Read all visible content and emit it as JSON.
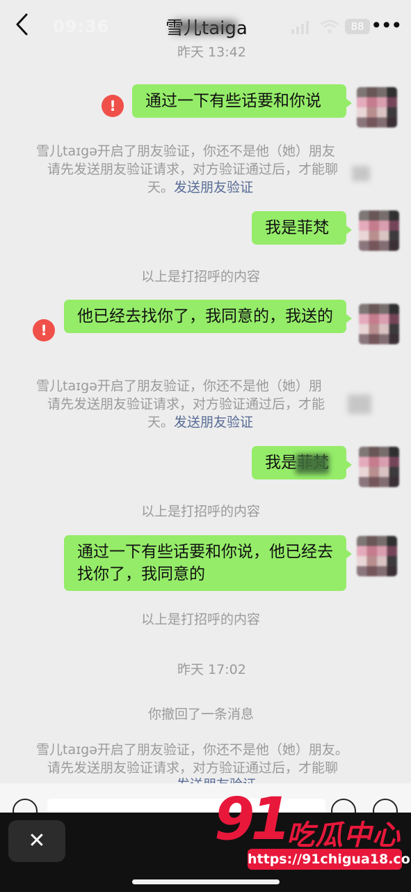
{
  "status_bar": {
    "time": "09:36",
    "battery": "88"
  },
  "header": {
    "title": "雪儿taiga"
  },
  "messages": {
    "ts1": "昨天 13:42",
    "b1": "通过一下有些话要和你说",
    "sys1_line1": "雪儿taɪgə开启了朋友验证，你还不是他（她）朋友",
    "sys1_line2": "请先发送朋友验证请求，对方验证通过后，才能聊",
    "sys1_line3": "天。",
    "sys1_link": "发送朋友验证",
    "b2": "我是菲梵",
    "hint1": "以上是打招呼的内容",
    "b3": "他已经去找你了，我同意的，我送的",
    "sys2_line1": "雪儿taɪgə开启了朋友验证，你还不是他（她）朋",
    "sys2_line2": "请先发送朋友验证请求，对方验证通过后，才能",
    "sys2_line3": "天。",
    "sys2_link": "发送朋友验证",
    "b4": "我是菲梵",
    "hint2": "以上是打招呼的内容",
    "b5": "通过一下有些话要和你说，他已经去找你了，我同意的",
    "hint3": "以上是打招呼的内容",
    "ts2": "昨天 17:02",
    "recall": "你撤回了一条消息",
    "sys3_line1": "雪儿taɪgə开启了朋友验证，你还不是他（她）朋友。",
    "sys3_line2": "请先发送朋友验证请求，对方验证通过后，才能聊",
    "sys3_link": "发送朋友验证"
  },
  "watermark": {
    "num": "91",
    "name": "吃瓜中心",
    "url": "https://91chigua18.com"
  },
  "colors": {
    "bubble": "#95ec69",
    "link": "#576b95",
    "error": "#f0504a",
    "watermark": "#e8183b"
  },
  "icons": [
    "back-icon",
    "signal-icon",
    "wifi-icon",
    "more-icon",
    "error-icon",
    "voice-icon",
    "emoji-icon",
    "plus-icon",
    "close-icon"
  ]
}
